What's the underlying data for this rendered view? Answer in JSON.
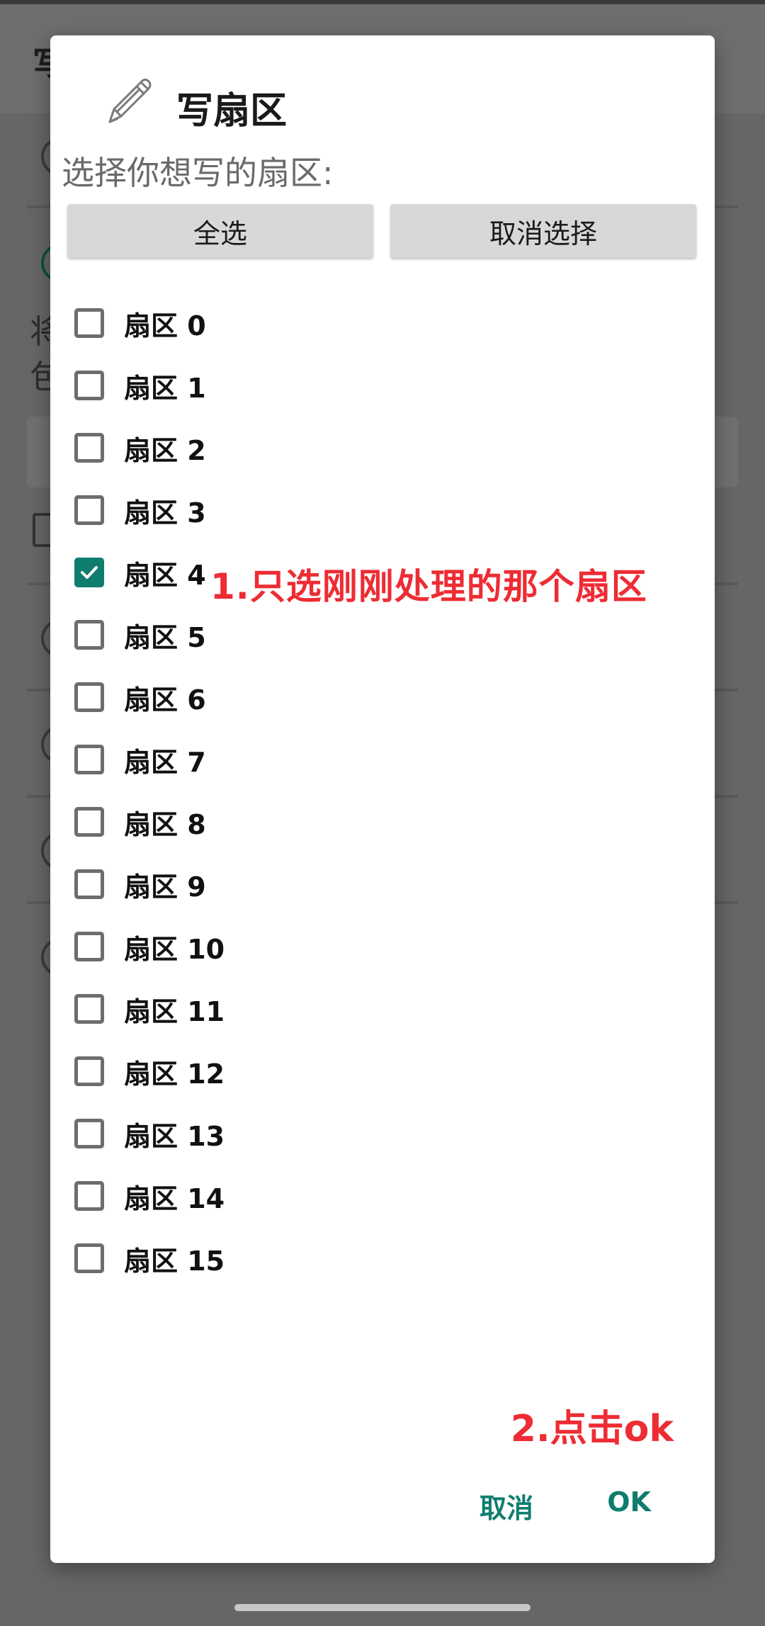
{
  "background": {
    "title_fragment": "写",
    "text_line1_fragment": "将",
    "text_line2_fragment": "包"
  },
  "dialog": {
    "title": "写扇区",
    "subtitle": "选择你想写的扇区:",
    "select_all_label": "全选",
    "deselect_all_label": "取消选择",
    "sectors": [
      {
        "label": "扇区 0",
        "checked": false
      },
      {
        "label": "扇区 1",
        "checked": false
      },
      {
        "label": "扇区 2",
        "checked": false
      },
      {
        "label": "扇区 3",
        "checked": false
      },
      {
        "label": "扇区 4",
        "checked": true
      },
      {
        "label": "扇区 5",
        "checked": false
      },
      {
        "label": "扇区 6",
        "checked": false
      },
      {
        "label": "扇区 7",
        "checked": false
      },
      {
        "label": "扇区 8",
        "checked": false
      },
      {
        "label": "扇区 9",
        "checked": false
      },
      {
        "label": "扇区 10",
        "checked": false
      },
      {
        "label": "扇区 11",
        "checked": false
      },
      {
        "label": "扇区 12",
        "checked": false
      },
      {
        "label": "扇区 13",
        "checked": false
      },
      {
        "label": "扇区 14",
        "checked": false
      },
      {
        "label": "扇区 15",
        "checked": false
      }
    ],
    "cancel_label": "取消",
    "ok_label": "OK"
  },
  "annotations": {
    "step1": "1.只选刚刚处理的那个扇区",
    "step2": "2.点击ok"
  },
  "colors": {
    "accent": "#0f7d6e",
    "annotation": "#ee2c34"
  }
}
